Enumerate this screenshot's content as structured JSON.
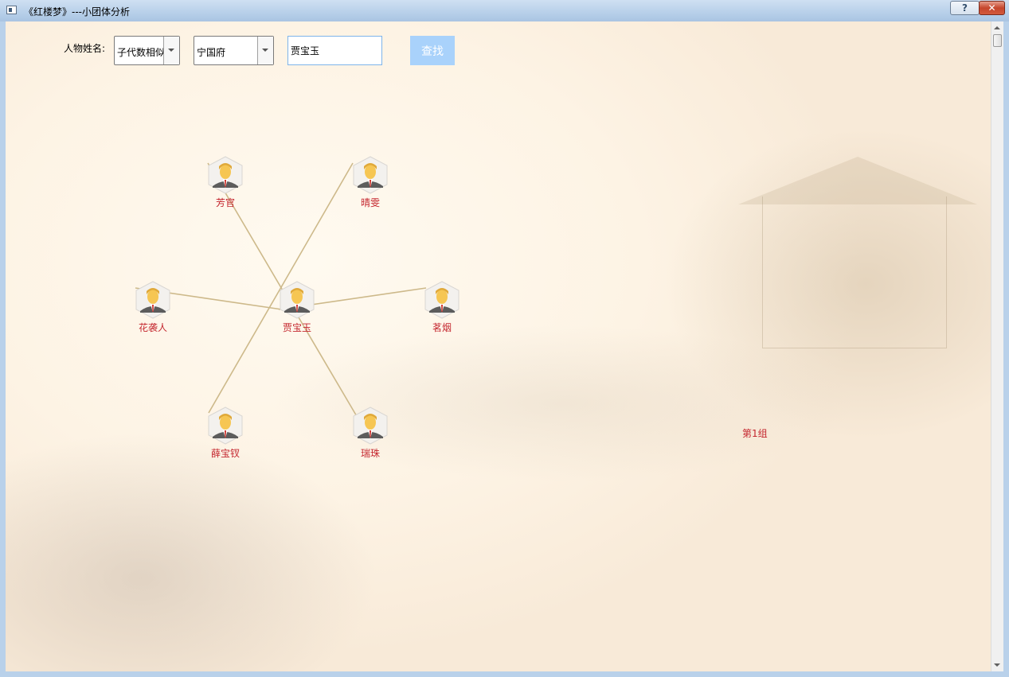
{
  "window": {
    "title": "《红楼梦》---小团体分析",
    "help_label": "?",
    "close_label": "✕"
  },
  "toolbar": {
    "name_label": "人物姓名:",
    "method_select": "子代数相似",
    "house_select": "宁国府",
    "name_value": "贾宝玉",
    "search_label": "查找"
  },
  "graph": {
    "center": "贾宝玉",
    "nodes": [
      "芳官",
      "晴雯",
      "花袭人",
      "茗烟",
      "薛宝钗",
      "瑞珠"
    ],
    "group_label": "第1组"
  },
  "colors": {
    "label_red": "#c4262e",
    "edge": "#cdb98a",
    "search_button": "#a9d2fb"
  },
  "icons": {
    "person": "person-avatar-icon"
  }
}
